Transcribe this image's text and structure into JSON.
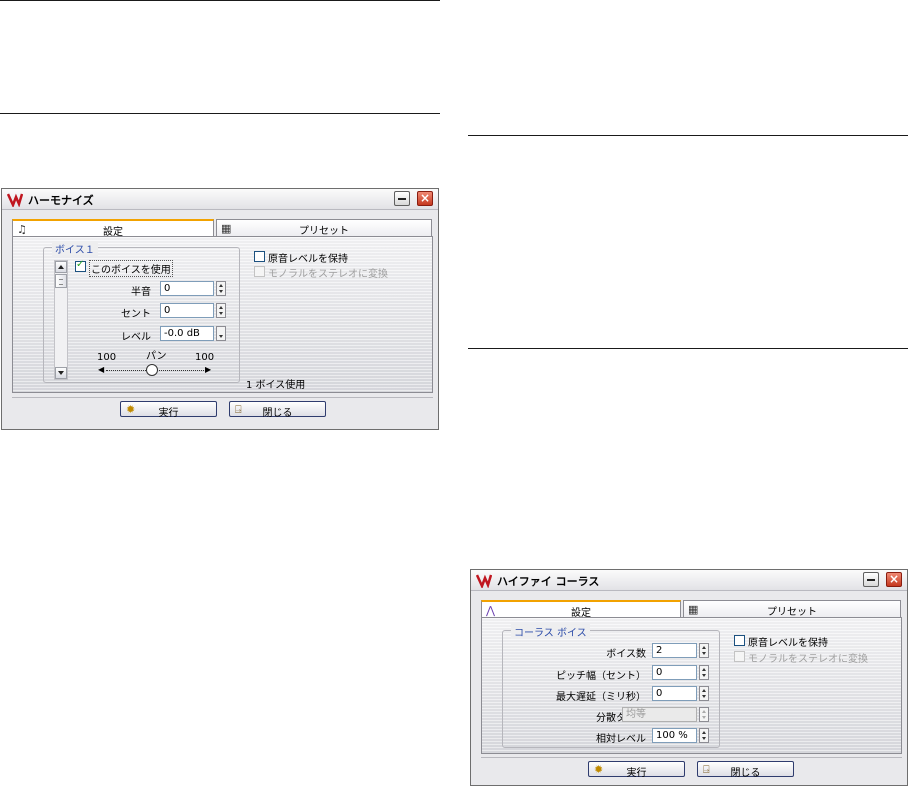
{
  "harmonize": {
    "title": "ハーモナイズ",
    "tabs": [
      {
        "label": "設定",
        "icon": "harmonize-icon"
      },
      {
        "label": "プリセット",
        "icon": "preset-icon"
      }
    ],
    "group_label": "ボイス１",
    "use_voice_label": "このボイスを使用",
    "use_voice_checked": true,
    "rows": [
      {
        "label": "半音",
        "value": "0"
      },
      {
        "label": "セント",
        "value": "0"
      },
      {
        "label": "レベル",
        "value": "-0.0 dB"
      }
    ],
    "pan": {
      "label": "パン",
      "left": "100",
      "right": "100",
      "position": 0.5
    },
    "keep_level_label": "原音レベルを保持",
    "mono_stereo_label": "モノラルをステレオに変換",
    "voices_used": "1 ボイス使用",
    "ok_label": "実行",
    "close_label": "閉じる"
  },
  "chorus": {
    "title": "ハイファイ コーラス",
    "tabs": [
      {
        "label": "設定",
        "icon": "chorus-icon"
      },
      {
        "label": "プリセット",
        "icon": "preset-icon"
      }
    ],
    "group_label": "コーラス ボイス",
    "rows": [
      {
        "label": "ボイス数",
        "value": "2"
      },
      {
        "label": "ピッチ幅（セント）",
        "value": "0"
      },
      {
        "label": "最大遅延（ミリ秒）",
        "value": "0"
      },
      {
        "label": "分散タイプ",
        "value": "均等"
      },
      {
        "label": "相対レベル",
        "value": "100 %"
      }
    ],
    "keep_level_label": "原音レベルを保持",
    "mono_stereo_label": "モノラルをステレオに変換",
    "ok_label": "実行",
    "close_label": "閉じる"
  },
  "colors": {
    "accent_tab": "#f2a200",
    "group_label": "#2a4aa8",
    "close_button": "#c5381f"
  }
}
